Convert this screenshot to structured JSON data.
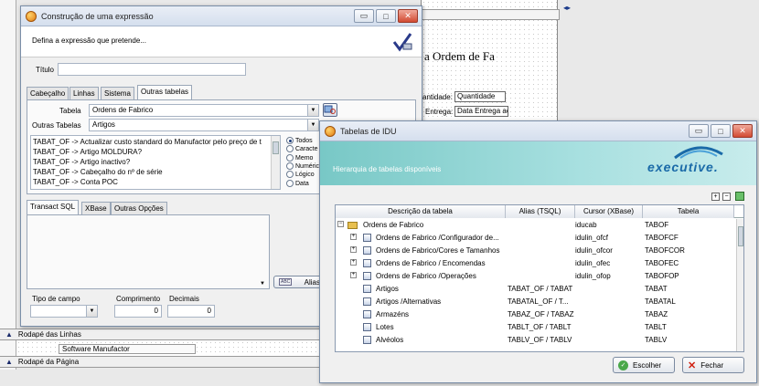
{
  "background": {
    "report_title_fragment": "a Ordem de Fa",
    "fields": [
      {
        "label": "antidade:",
        "value": "Quantidade"
      },
      {
        "label": "Entrega:",
        "value": "Data Entrega ac"
      }
    ],
    "bands": [
      "Rodapé das Linhas",
      "Rodapé da Página"
    ],
    "band_item": "Software Manufactor"
  },
  "expression_dialog": {
    "title": "Construção de uma expressão",
    "subtitle": "Defina a expressão que pretende...",
    "titulo_label": "Título",
    "titulo_value": "",
    "tabs": [
      "Cabeçalho",
      "Linhas",
      "Sistema",
      "Outras tabelas"
    ],
    "tabela_label": "Tabela",
    "tabela_value": "Ordens de Fabrico",
    "outras_label": "Outras Tabelas",
    "outras_value": "Artigos",
    "list_items": [
      "TABAT_OF -> Actualizar custo standard do Manufactor pelo preço de t",
      "TABAT_OF -> Artigo MOLDURA?",
      "TABAT_OF -> Artigo inactivo?",
      "TABAT_OF -> Cabeçalho do nº de série",
      "TABAT_OF -> Conta POC"
    ],
    "radio_options": [
      "Todos",
      "Caracte",
      "Memo",
      "Numéric",
      "Lógico",
      "Data"
    ],
    "radio_selected": "Todos",
    "lower_tabs": [
      "Transact SQL",
      "XBase",
      "Outras Opções"
    ],
    "alias_button": "Alias",
    "tipo_label": "Tipo de campo",
    "comprimento_label": "Comprimento",
    "comprimento_value": "0",
    "decimais_label": "Decimais",
    "decimais_value": "0"
  },
  "tables_dialog": {
    "title": "Tabelas de IDU",
    "header_subtitle": "Hierarquia de tabelas disponíveis",
    "brand": "executive.",
    "columns": [
      "Descrição da tabela",
      "Alias (TSQL)",
      "Cursor (XBase)",
      "Tabela"
    ],
    "rows": [
      {
        "level": 0,
        "expander": "−",
        "desc": "Ordens de Fabrico",
        "alias": "",
        "cursor": "iducab",
        "tabela": "TABOF",
        "folder": true
      },
      {
        "level": 1,
        "expander": "+",
        "desc": "Ordens de Fabrico /Configurador de...",
        "alias": "",
        "cursor": "idulin_ofcf",
        "tabela": "TABOFCF"
      },
      {
        "level": 1,
        "expander": "+",
        "desc": "Ordens de Fabrico/Cores e Tamanhos",
        "alias": "",
        "cursor": "idulin_ofcor",
        "tabela": "TABOFCOR"
      },
      {
        "level": 1,
        "expander": "+",
        "desc": "Ordens de Fabrico / Encomendas",
        "alias": "",
        "cursor": "idulin_ofec",
        "tabela": "TABOFEC"
      },
      {
        "level": 1,
        "expander": "+",
        "desc": "Ordens de Fabrico /Operações",
        "alias": "",
        "cursor": "idulin_ofop",
        "tabela": "TABOFOP"
      },
      {
        "level": 1,
        "expander": "",
        "desc": "Artigos",
        "alias": "TABAT_OF / TABAT",
        "cursor": "",
        "tabela": "TABAT"
      },
      {
        "level": 1,
        "expander": "",
        "desc": "Artigos /Alternativas",
        "alias": "TABATAL_OF / T...",
        "cursor": "",
        "tabela": "TABATAL"
      },
      {
        "level": 1,
        "expander": "",
        "desc": "Armazéns",
        "alias": "TABAZ_OF / TABAZ",
        "cursor": "",
        "tabela": "TABAZ"
      },
      {
        "level": 1,
        "expander": "",
        "desc": "Lotes",
        "alias": "TABLT_OF / TABLT",
        "cursor": "",
        "tabela": "TABLT"
      },
      {
        "level": 1,
        "expander": "",
        "desc": "Alvéolos",
        "alias": "TABLV_OF / TABLV",
        "cursor": "",
        "tabela": "TABLV"
      }
    ],
    "escolher_button": "Escolher",
    "fechar_button": "Fechar"
  }
}
